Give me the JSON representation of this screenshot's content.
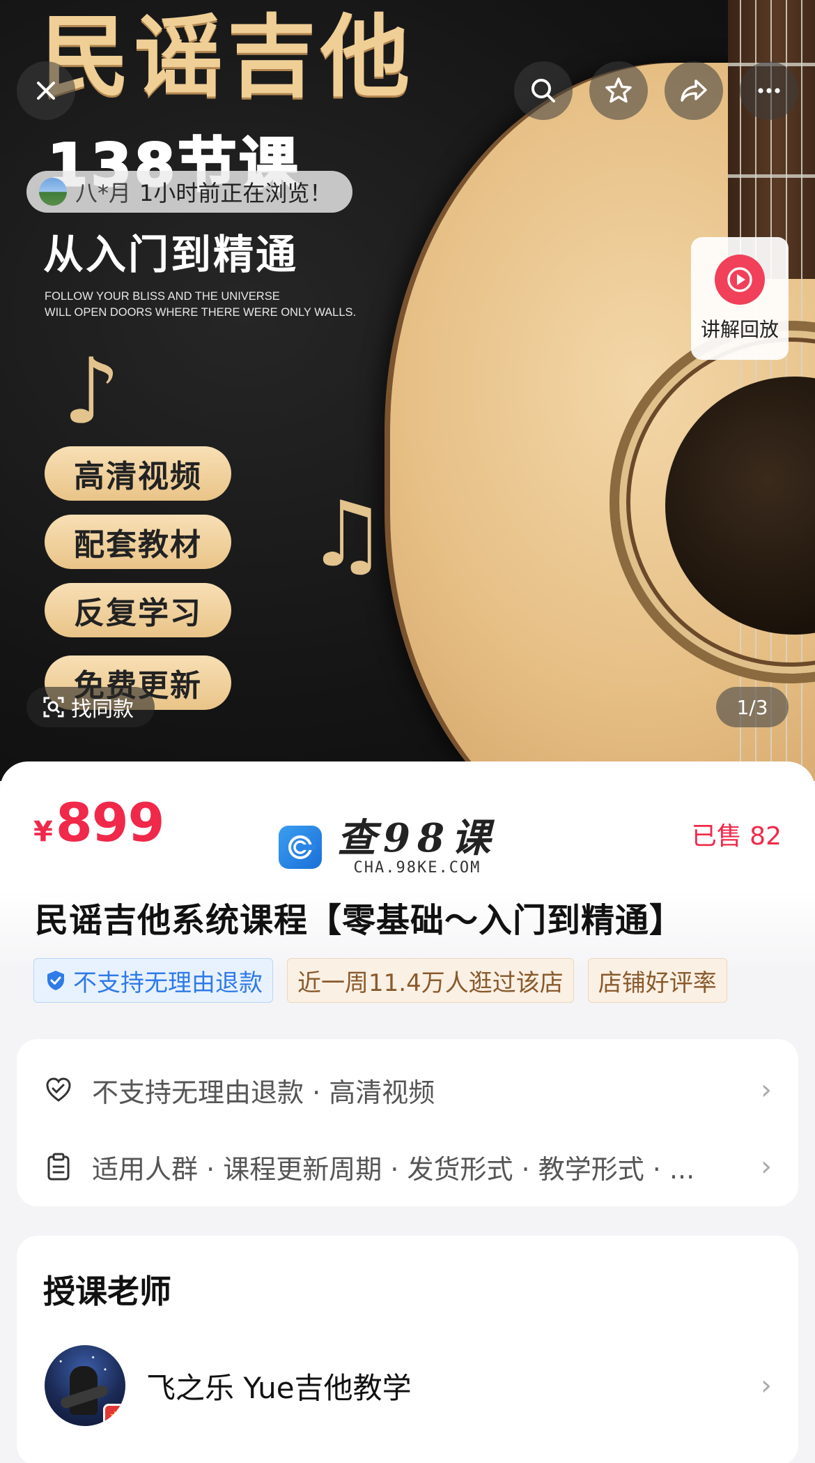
{
  "hero": {
    "title": "民谣吉他",
    "subtitle": "138节课",
    "tagline": "从入门到精通",
    "english_line1": "FOLLOW YOUR BLISS AND THE UNIVERSE",
    "english_line2": "WILL OPEN DOORS WHERE THERE WERE ONLY WALLS.",
    "features": [
      "高清视频",
      "配套教材",
      "反复学习",
      "免费更新"
    ],
    "browse": {
      "name": "八*月",
      "action": "1小时前正在浏览！"
    },
    "replay_label": "讲解回放",
    "find_same_label": "找同款",
    "pager": "1/3",
    "note_glyph": "♪",
    "note_glyph_2": "♫"
  },
  "top_icons": [
    "close-icon",
    "search-icon",
    "star-icon",
    "share-icon",
    "more-icon"
  ],
  "product": {
    "currency": "¥",
    "price": "899",
    "sold": "已售 82",
    "title": "民谣吉他系统课程【零基础～入门到精通】",
    "tags": [
      {
        "text": "不支持无理由退款",
        "style": "blue",
        "icon": "shield-check-icon"
      },
      {
        "text": "近一周11.4万人逛过该店",
        "style": "beige"
      },
      {
        "text": "店铺好评率",
        "style": "beige"
      }
    ]
  },
  "watermark": {
    "cn": "查98课",
    "en": "CHA.98KE.COM"
  },
  "service": {
    "rows": [
      {
        "icon": "heart-shield-icon",
        "text": "不支持无理由退款 · 高清视频"
      },
      {
        "icon": "clipboard-icon",
        "text": "适用人群 · 课程更新周期 · 发货形式 · 教学形式 · ..."
      }
    ]
  },
  "teacher": {
    "heading": "授课老师",
    "name": "飞之乐 Yue吉他教学"
  },
  "colors": {
    "accent_red": "#f0284a",
    "gold": "#f0cf96",
    "tag_blue": "#2f7be8",
    "tag_beige_text": "#8a5a2c"
  },
  "chevron": "›"
}
